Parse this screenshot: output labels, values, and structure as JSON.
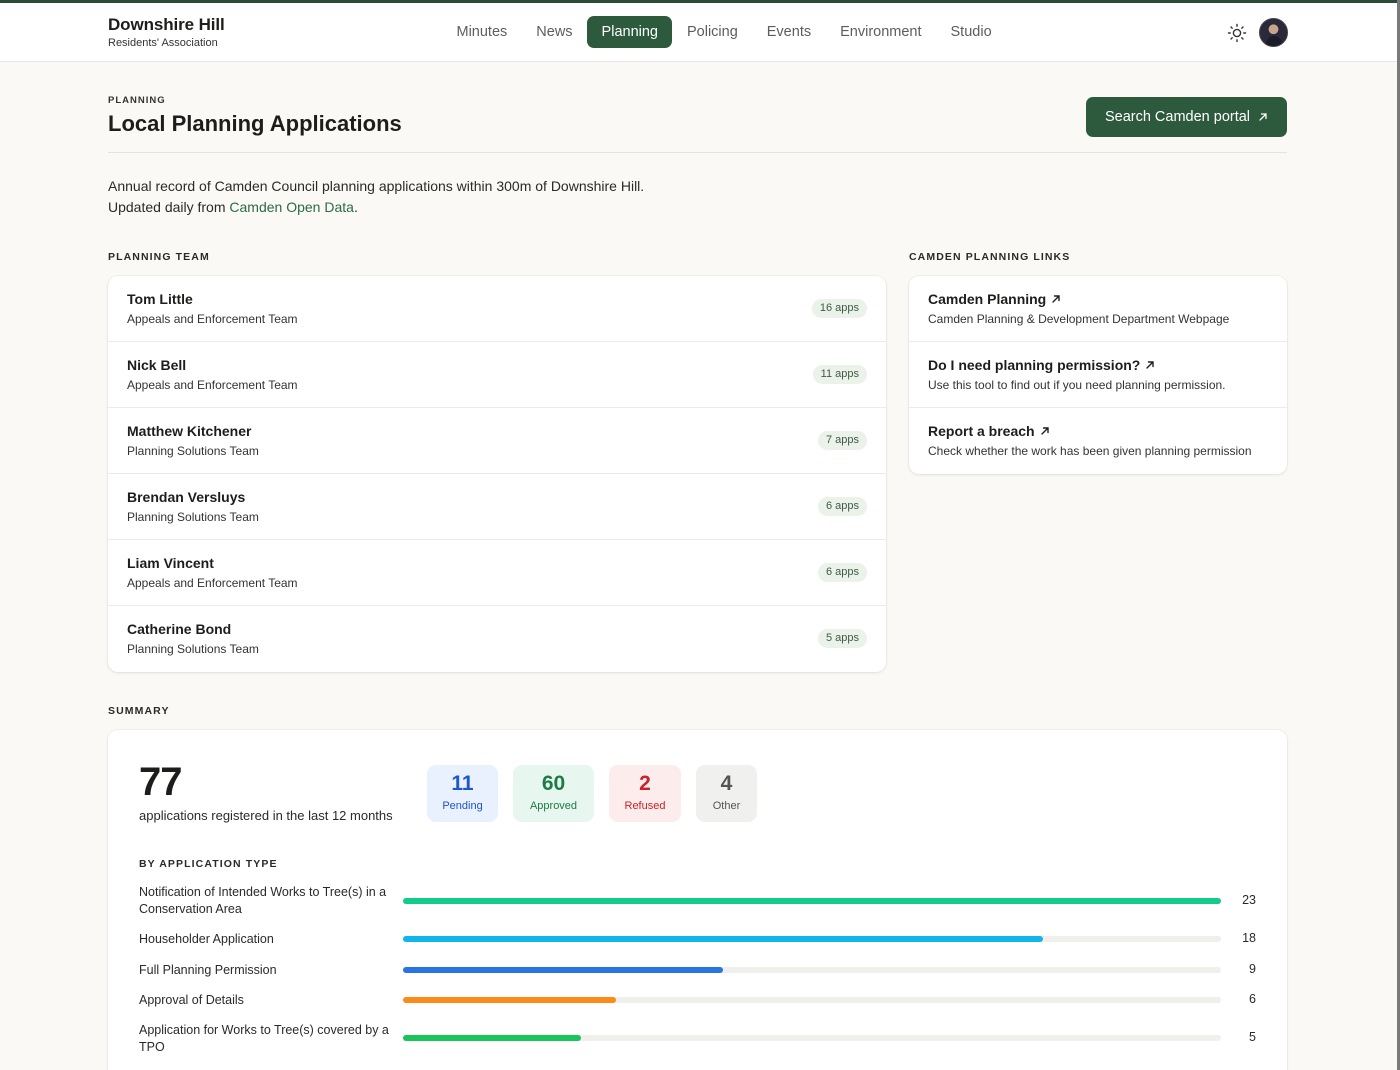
{
  "brand": {
    "title": "Downshire Hill",
    "subtitle": "Residents' Association"
  },
  "nav": {
    "items": [
      {
        "label": "Minutes",
        "active": false
      },
      {
        "label": "News",
        "active": false
      },
      {
        "label": "Planning",
        "active": true
      },
      {
        "label": "Policing",
        "active": false
      },
      {
        "label": "Events",
        "active": false
      },
      {
        "label": "Environment",
        "active": false
      },
      {
        "label": "Studio",
        "active": false
      }
    ],
    "theme_icon": "sun-icon",
    "avatar_icon": "user-avatar"
  },
  "page": {
    "eyebrow": "PLANNING",
    "title": "Local Planning Applications",
    "portal_button": "Search Camden portal",
    "intro_text": "Annual record of Camden Council planning applications within 300m of Downshire Hill. Updated daily from ",
    "intro_link": "Camden Open Data",
    "intro_end": "."
  },
  "team": {
    "label": "PLANNING TEAM",
    "members": [
      {
        "name": "Tom Little",
        "team": "Appeals and Enforcement Team",
        "apps": "16 apps"
      },
      {
        "name": "Nick Bell",
        "team": "Appeals and Enforcement Team",
        "apps": "11 apps"
      },
      {
        "name": "Matthew Kitchener",
        "team": "Planning Solutions Team",
        "apps": "7 apps"
      },
      {
        "name": "Brendan Versluys",
        "team": "Planning Solutions Team",
        "apps": "6 apps"
      },
      {
        "name": "Liam Vincent",
        "team": "Appeals and Enforcement Team",
        "apps": "6 apps"
      },
      {
        "name": "Catherine Bond",
        "team": "Planning Solutions Team",
        "apps": "5 apps"
      }
    ]
  },
  "links": {
    "label": "CAMDEN PLANNING LINKS",
    "items": [
      {
        "title": "Camden Planning",
        "desc": "Camden Planning & Development Department Webpage"
      },
      {
        "title": "Do I need planning permission?",
        "desc": "Use this tool to find out if you need planning permission."
      },
      {
        "title": "Report a breach",
        "desc": "Check whether the work has been given planning permission"
      }
    ]
  },
  "summary": {
    "label": "SUMMARY",
    "total": "77",
    "caption": "applications registered in the last 12 months",
    "stats": [
      {
        "value": "11",
        "label": "Pending",
        "bg": "#e8f1fd",
        "color": "#1f56c9"
      },
      {
        "value": "60",
        "label": "Approved",
        "bg": "#e7f6ee",
        "color": "#1e7a47"
      },
      {
        "value": "2",
        "label": "Refused",
        "bg": "#fdecec",
        "color": "#c8232c"
      },
      {
        "value": "4",
        "label": "Other",
        "bg": "#f0f0ee",
        "color": "#555555"
      }
    ],
    "types_label": "BY APPLICATION TYPE",
    "max": 23,
    "types": [
      {
        "label": "Notification of Intended Works to Tree(s) in a Conservation Area",
        "count": 23,
        "color": "#12cc8b"
      },
      {
        "label": "Householder Application",
        "count": 18,
        "color": "#12b5ea"
      },
      {
        "label": "Full Planning Permission",
        "count": 9,
        "color": "#2874e0"
      },
      {
        "label": "Approval of Details",
        "count": 6,
        "color": "#fb8c1a"
      },
      {
        "label": "Application for Works to Tree(s) covered by a TPO",
        "count": 5,
        "color": "#19c55a"
      }
    ]
  }
}
